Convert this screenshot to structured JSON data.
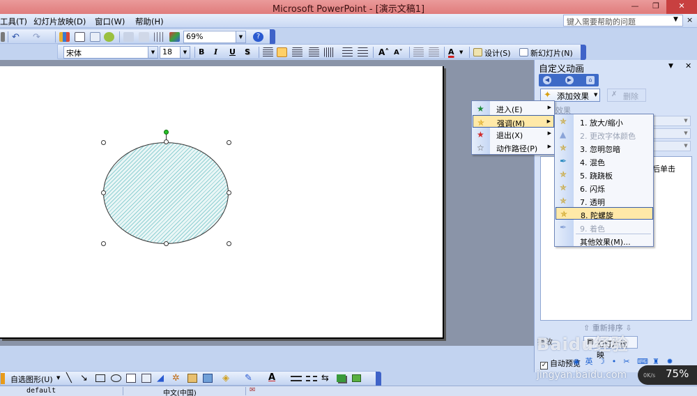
{
  "window": {
    "title": "Microsoft PowerPoint - [演示文稿1]",
    "controls": [
      "—",
      "❐",
      "✕"
    ]
  },
  "menubar": {
    "items": [
      "工具(T)",
      "幻灯片放映(D)",
      "窗口(W)",
      "帮助(H)"
    ],
    "help_placeholder": "键入需要帮助的问题",
    "help_close": "×"
  },
  "standard_toolbar": {
    "zoom": "69%"
  },
  "format_toolbar": {
    "font": "宋体",
    "size": "18",
    "bold": "B",
    "italic": "I",
    "underline": "U",
    "shadow": "S",
    "design": "设计(S)",
    "new_slide": "新幻灯片(N)"
  },
  "taskpane": {
    "title": "自定义动画",
    "add_effect": "添加效果",
    "remove": "删除",
    "effect_label": "效果",
    "list_text": "后单击",
    "reorder": "重新排序",
    "play": "播放",
    "slideshow": "幻灯片放映",
    "autopreview": "自动预览",
    "autopreview_check": "✓"
  },
  "effect_menu": {
    "items": [
      {
        "label": "进入(E)",
        "icon": "star-green-icon"
      },
      {
        "label": "强调(M)",
        "icon": "star-yellow-icon",
        "highlighted": true
      },
      {
        "label": "退出(X)",
        "icon": "star-red-icon"
      },
      {
        "label": "动作路径(P)",
        "icon": "star-outline-icon"
      }
    ]
  },
  "emphasis_menu": {
    "items": [
      {
        "label": "1. 放大/缩小",
        "disabled": false
      },
      {
        "label": "2. 更改字体颜色",
        "disabled": true
      },
      {
        "label": "3. 忽明忽暗",
        "disabled": false
      },
      {
        "label": "4. 混色",
        "disabled": false
      },
      {
        "label": "5. 跷跷板",
        "disabled": false
      },
      {
        "label": "6. 闪烁",
        "disabled": false
      },
      {
        "label": "7. 透明",
        "disabled": false
      },
      {
        "label": "8. 陀螺旋",
        "disabled": false,
        "highlighted": true
      },
      {
        "label": "9. 着色",
        "disabled": true
      }
    ],
    "more": "其他效果(M)..."
  },
  "drawing_toolbar": {
    "autoshapes": "自选图形(U)"
  },
  "statusbar": {
    "design": "default",
    "language": "中文(中国)"
  },
  "overlay": {
    "zoom_widget": "75%",
    "zoom_sub": "0K/s",
    "watermark": "Baidu经验",
    "watermark_url": "jingyan.baidu.com"
  },
  "colors": {
    "accent_blue": "#3d6ac7",
    "highlight": "#ffe9a8",
    "title_bar": "#e07c7c"
  }
}
